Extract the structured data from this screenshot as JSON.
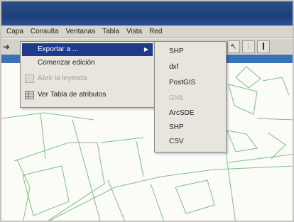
{
  "menubar": {
    "items": [
      "Capa",
      "Consulta",
      "Ventanas",
      "Tabla",
      "Vista",
      "Red"
    ]
  },
  "submenu": {
    "items": [
      {
        "label": "Exportar a ...",
        "has_submenu": true,
        "active": true,
        "enabled": true,
        "icon": null
      },
      {
        "label": "Comenzar edición",
        "has_submenu": false,
        "active": false,
        "enabled": true,
        "icon": null
      },
      {
        "label": "Abrir la leyenda",
        "has_submenu": false,
        "active": false,
        "enabled": false,
        "icon": "legend-icon"
      },
      {
        "label": "Ver Tabla de atributos",
        "has_submenu": false,
        "active": false,
        "enabled": true,
        "icon": "table-icon"
      }
    ],
    "arrow_glyph": "▶"
  },
  "export_formats": {
    "items": [
      {
        "label": "SHP",
        "enabled": true
      },
      {
        "label": "dxf",
        "enabled": true
      },
      {
        "label": "PostGIS",
        "enabled": true
      },
      {
        "label": "GML",
        "enabled": false
      },
      {
        "label": "ArcSDE",
        "enabled": true
      },
      {
        "label": "SHP",
        "enabled": true
      },
      {
        "label": "CSV",
        "enabled": true
      }
    ]
  },
  "toolbar": {
    "left_icon": "cursor-icon",
    "right_buttons": [
      {
        "icon": "select-icon",
        "glyph": "↖",
        "enabled": true
      },
      {
        "icon": "info-icon",
        "glyph": "i",
        "enabled": false
      },
      {
        "icon": "text-cursor-icon",
        "glyph": "I",
        "enabled": true
      }
    ]
  },
  "colors": {
    "title_bar": "#1d3f7a",
    "menu_highlight": "#1e3a8a",
    "map_lines": "#7dc27d",
    "map_background": "#fbfbf8"
  }
}
